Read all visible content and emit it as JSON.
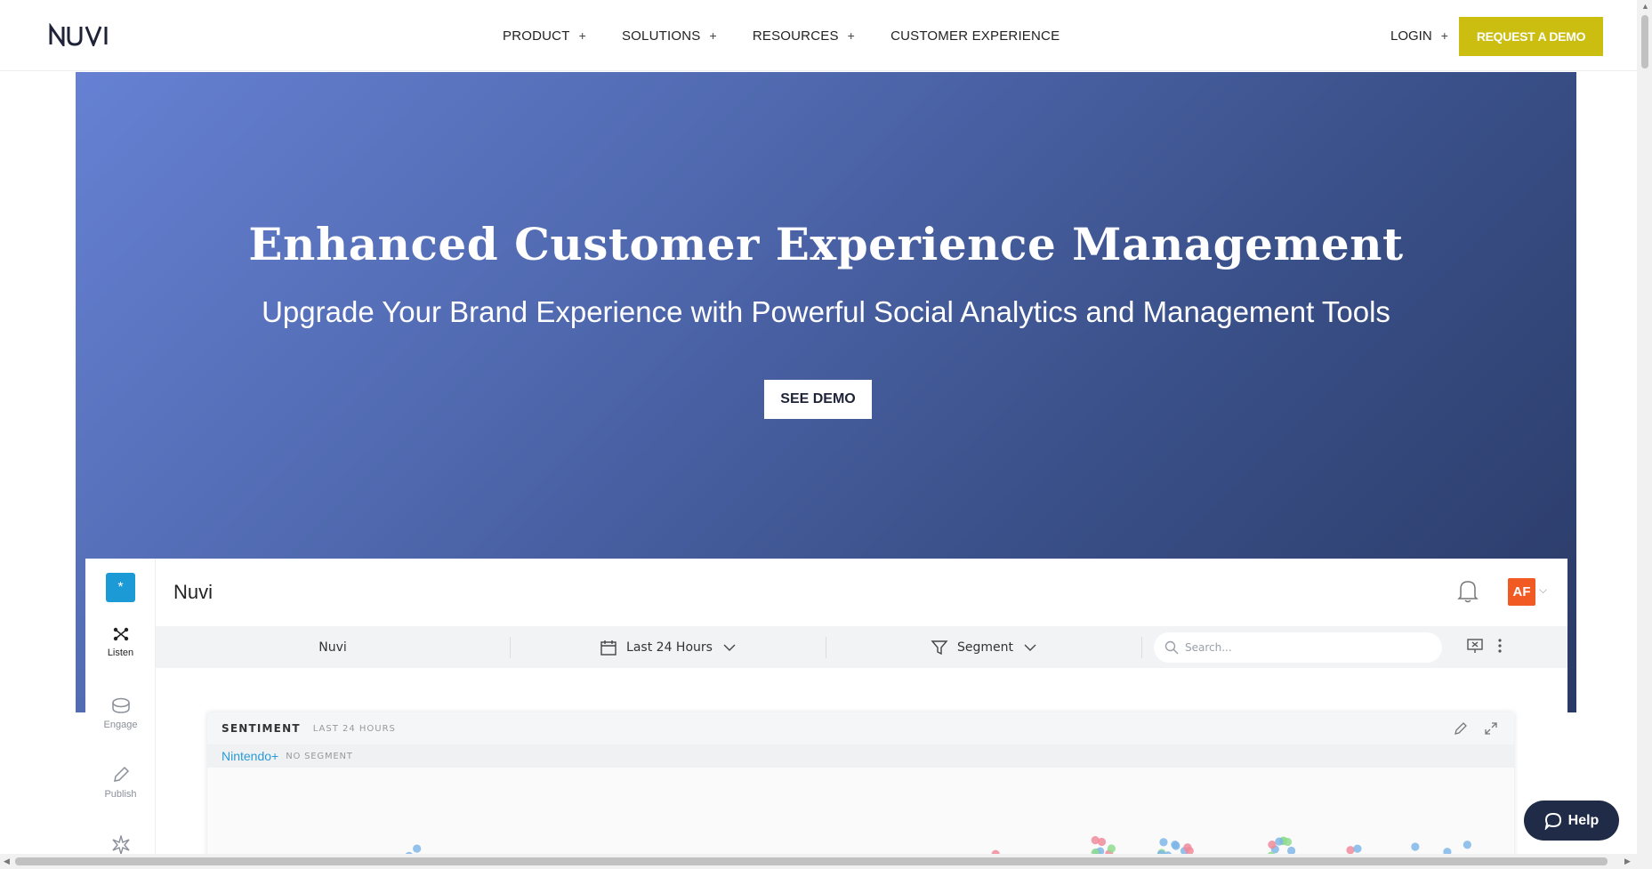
{
  "brand": {
    "logo_text": "NUVI"
  },
  "nav": {
    "items": [
      {
        "label": "PRODUCT",
        "expand": "+"
      },
      {
        "label": "SOLUTIONS",
        "expand": "+"
      },
      {
        "label": "RESOURCES",
        "expand": "+"
      },
      {
        "label": "CUSTOMER EXPERIENCE",
        "expand": ""
      }
    ],
    "login_label": "LOGIN",
    "login_expand": "+",
    "demo_label": "REQUEST A DEMO"
  },
  "hero": {
    "title": "Enhanced Customer Experience Management",
    "subtitle": "Upgrade Your Brand Experience with Powerful Social Analytics and Management Tools",
    "cta_label": "SEE DEMO"
  },
  "app": {
    "logo_glyph": "*",
    "title": "Nuvi",
    "avatar_initials": "AF",
    "avatar_caret": "⌵",
    "rail": [
      {
        "label": "Listen",
        "icon": "network-icon"
      },
      {
        "label": "Engage",
        "icon": "engage-icon"
      },
      {
        "label": "Publish",
        "icon": "pencil-icon"
      }
    ],
    "toolbar": {
      "account": "Nuvi",
      "range": "Last 24 Hours",
      "segment": "Segment",
      "search_placeholder": "Search..."
    },
    "card": {
      "title": "SENTIMENT",
      "range": "LAST 24 HOURS",
      "brand": "Nintendo+",
      "segment": "NO SEGMENT"
    },
    "sentiment_colors": {
      "neutral": "#7fb6e8",
      "positive": "#8fdc8f",
      "negative": "#f08a9a"
    }
  },
  "help": {
    "label": "Help"
  },
  "colors": {
    "accent": "#cbbe10",
    "hero_start": "#6681d3",
    "hero_end": "#2a3a66",
    "help_bg": "#1f2b47"
  }
}
